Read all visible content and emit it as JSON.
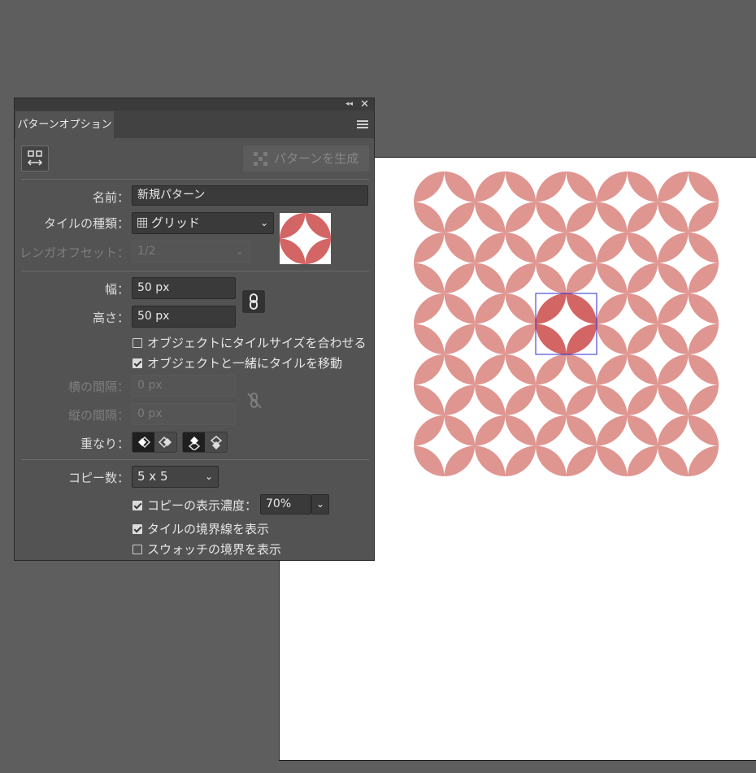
{
  "panel": {
    "tab_label": "パターンオプション",
    "generate_label": "パターンを生成",
    "name_label": "名前：",
    "name_value": "新規パターン",
    "tile_type_label": "タイルの種類：",
    "tile_type_value": "グリッド",
    "brick_offset_label": "レンガオフセット：",
    "brick_offset_value": "1/2",
    "width_label": "幅：",
    "width_value": "50 px",
    "height_label": "高さ：",
    "height_value": "50 px",
    "fit_tile_label": "オブジェクトにタイルサイズを合わせる",
    "fit_tile_checked": false,
    "move_tile_label": "オブジェクトと一緒にタイルを移動",
    "move_tile_checked": true,
    "h_spacing_label": "横の間隔：",
    "h_spacing_value": "0 px",
    "v_spacing_label": "縦の間隔：",
    "v_spacing_value": "0 px",
    "overlap_label": "重なり：",
    "copies_label": "コピー数：",
    "copies_value": "5 x 5",
    "dim_copies_label": "コピーの表示濃度：",
    "dim_copies_checked": true,
    "dim_copies_value": "70%",
    "show_tile_edge_label": "タイルの境界線を表示",
    "show_tile_edge_checked": true,
    "show_swatch_bounds_label": "スウォッチの境界を表示",
    "show_swatch_bounds_checked": false
  },
  "pattern": {
    "color_main": "#d36565",
    "color_copies": "#df9590",
    "selection_color": "#2a2ad0",
    "grid": "5 x 5",
    "highlight_cell": [
      2,
      2
    ]
  }
}
